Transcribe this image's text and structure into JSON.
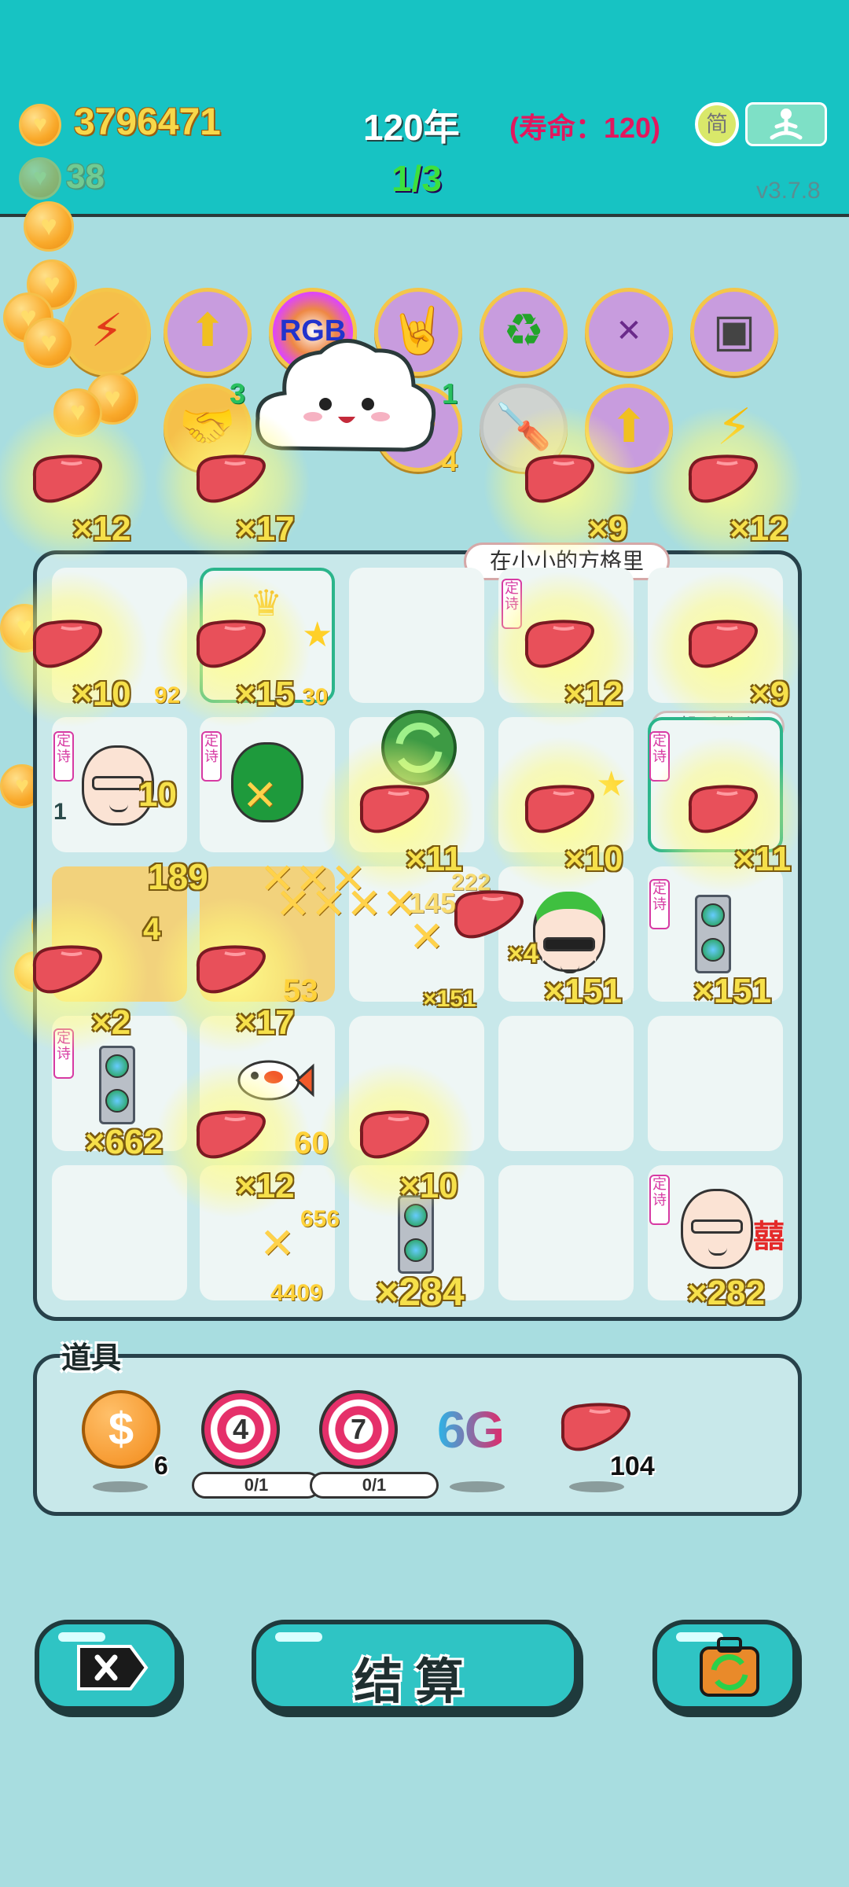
{
  "header": {
    "coins": "3796471",
    "secondary_coins": "38",
    "year": "120年",
    "lifespan": "(寿命：120)",
    "level": "1/3",
    "version": "v3.7.8",
    "lang_button": "简"
  },
  "relics_row1": [
    {
      "icon": "lightning-icon",
      "glyph": "⚡"
    },
    {
      "icon": "bowls-arrow-icon",
      "glyph": "⬆"
    },
    {
      "icon": "rgb-icon",
      "glyph": "RGB"
    },
    {
      "icon": "rock-hand-icon",
      "glyph": "🤘"
    },
    {
      "icon": "recycle-icon",
      "glyph": "♻"
    },
    {
      "icon": "math-head-icon",
      "glyph": "✕"
    },
    {
      "icon": "chip-icon",
      "glyph": "▣"
    }
  ],
  "relics_row2": [
    {
      "icon": "handshake-icon",
      "glyph": "🤝",
      "count": "3"
    },
    {
      "icon": "flower-icon",
      "glyph": "✿",
      "count": "1"
    },
    {
      "icon": "screwdriver-icon",
      "glyph": "🪛"
    },
    {
      "icon": "bowls-arrow-icon",
      "glyph": "⬆"
    },
    {
      "icon": "triple-lightning-icon",
      "glyph": "⚡"
    }
  ],
  "extra_counts": {
    "relic_four": "4"
  },
  "board": {
    "tooltip": "在小小的方格里",
    "tooltip2": "投币成功",
    "tags": "定诗",
    "labels": {
      "b1": "×12",
      "b2": "×17",
      "b3": "×9",
      "b4": "×12",
      "c1": "×10",
      "c2": "×15",
      "c3": "×12",
      "c4": "×9",
      "d1": "×11",
      "d2": "×10",
      "d3": "×11",
      "e1": "×2",
      "e2": "×17",
      "e3": "×151",
      "e4": "×151",
      "e5": "×4",
      "e6": "×151",
      "f1": "×662",
      "f2": "×12",
      "f3": "×10",
      "g1": "×284",
      "g2": "×282",
      "n189": "189",
      "n10": "10",
      "n4": "4",
      "n1": "1",
      "n30": "30",
      "n60": "60",
      "n656": "656",
      "n4409": "4409",
      "n145": "145",
      "n53": "53",
      "n92": "92",
      "n222": "222"
    }
  },
  "props": {
    "title": "道具",
    "dollar_count": "6",
    "target1_label": "4",
    "target1_progress": "0/1",
    "target2_label": "7",
    "target2_progress": "0/1",
    "sixg": "6G",
    "liver_count": "104"
  },
  "footer": {
    "settle_label": "结算"
  },
  "colors": {
    "teal": "#17c3c3",
    "board_bg": "#c8e8ea",
    "accent_gold": "#f6e04a",
    "life_red": "#e3175e",
    "level_green": "#3de03d"
  }
}
